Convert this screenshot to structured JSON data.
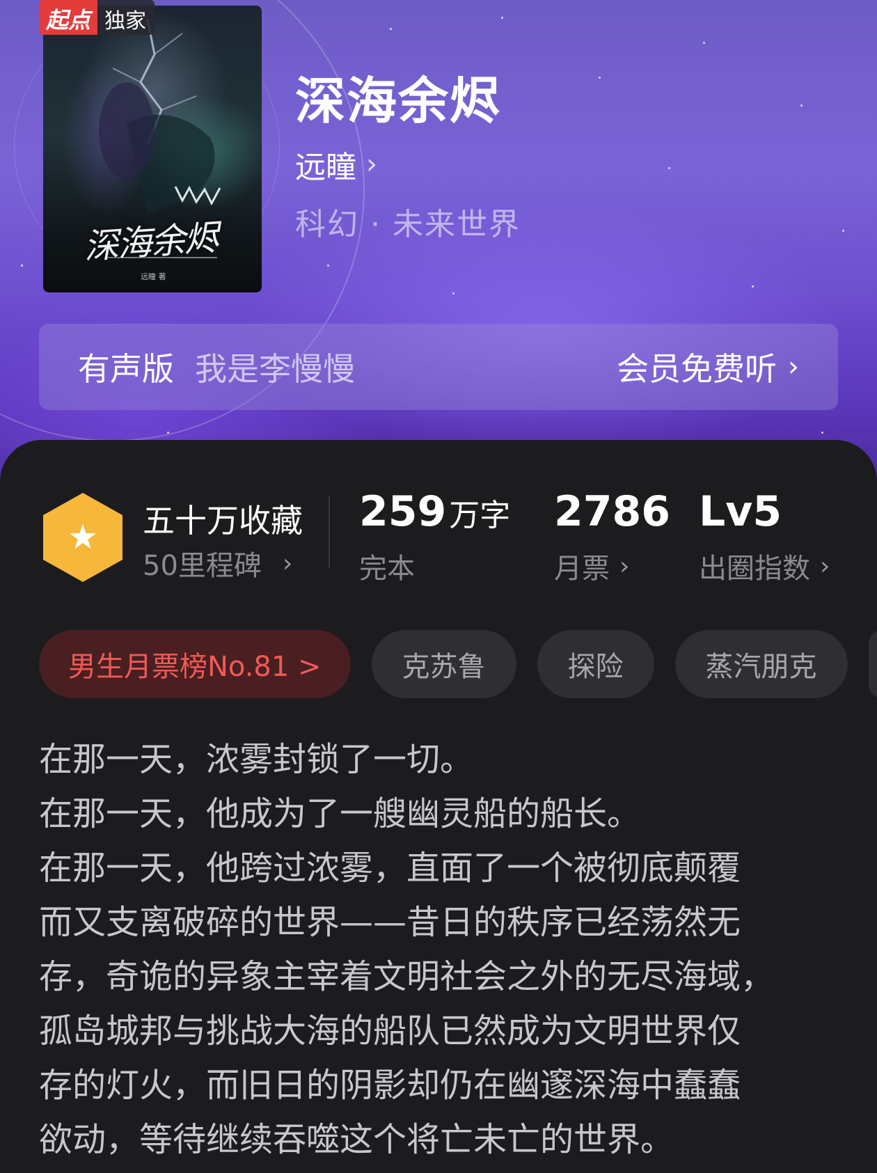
{
  "badge": {
    "brand": "起点",
    "label": "独家"
  },
  "cover": {
    "title": "深海余烬",
    "author": "远瞳 著"
  },
  "book": {
    "title": "深海余烬",
    "author": "远瞳",
    "genre": "科幻 · 未来世界"
  },
  "audio": {
    "label": "有声版",
    "narrator": "我是李慢慢",
    "cta": "会员免费听"
  },
  "stats": {
    "milestone": {
      "title": "五十万收藏",
      "sub": "50里程碑"
    },
    "words": {
      "value": "259",
      "unit": "万字",
      "sub": "完本"
    },
    "votes": {
      "value": "2786",
      "sub": "月票"
    },
    "influence": {
      "value": "Lv5",
      "sub": "出圈指数"
    }
  },
  "tags": {
    "rank": "男生月票榜No.81 >",
    "items": [
      "克苏鲁",
      "探险",
      "蒸汽朋克"
    ]
  },
  "synopsis": [
    "在那一天，浓雾封锁了一切。",
    "在那一天，他成为了一艘幽灵船的船长。",
    "在那一天，他跨过浓雾，直面了一个被彻底颠覆",
    "而又支离破碎的世界——昔日的秩序已经荡然无",
    "存，奇诡的异象主宰着文明社会之外的无尽海域，",
    "孤岛城邦与挑战大海的船队已然成为文明世界仅",
    "存的灯火，而旧日的阴影却仍在幽邃深海中蠢蠢",
    "欲动，等待继续吞噬这个将亡未亡的世界。"
  ],
  "colors": {
    "header_purple": "#7a63d6",
    "panel_bg": "#1c1b1e",
    "badge_red": "#e43b3b",
    "milestone_gold": "#f6b73a",
    "rank_text": "#f05a55"
  },
  "icons": {
    "chevron": "chevron-right-icon",
    "milestone": "star-hexagon-icon"
  }
}
